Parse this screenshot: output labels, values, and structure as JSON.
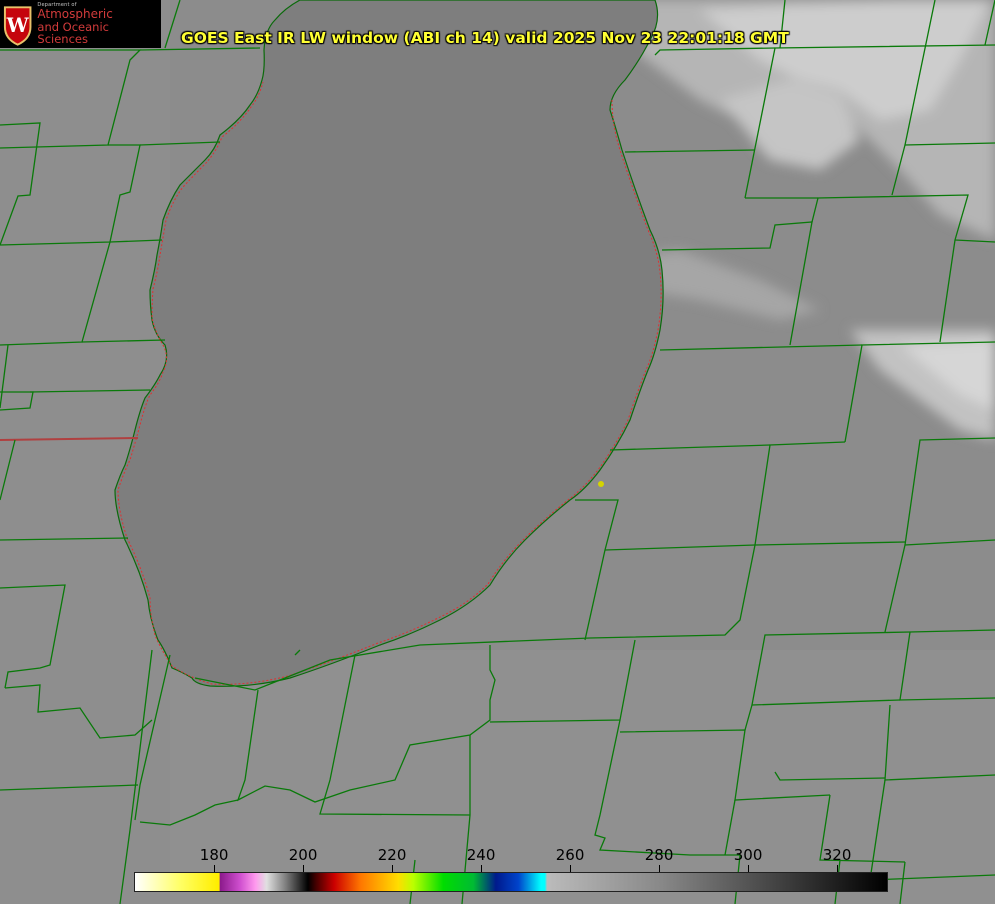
{
  "logo": {
    "dept": "Department of",
    "line1": "Atmospheric",
    "line2": "and Oceanic Sciences",
    "seal_letter": "W"
  },
  "title": "GOES East IR LW window (ABI ch 14) valid 2025 Nov 23 22:01:18 GMT",
  "colorbar": {
    "ticks": [
      {
        "label": "180",
        "value": 180
      },
      {
        "label": "200",
        "value": 200
      },
      {
        "label": "220",
        "value": 220
      },
      {
        "label": "240",
        "value": 240
      },
      {
        "label": "260",
        "value": 260
      },
      {
        "label": "280",
        "value": 280
      },
      {
        "label": "300",
        "value": 300
      },
      {
        "label": "320",
        "value": 320
      }
    ],
    "min": 162,
    "max": 331
  },
  "colors": {
    "background_gray": "#8a8a8a",
    "lake_gray": "#7f7f7f",
    "cloud_light": "#cfcfcf",
    "county_lines": "#0a7a0a",
    "shoreline_dots": "#e03030",
    "title_yellow": "#ffff33",
    "marker_yellow": "#d4d400"
  },
  "map": {
    "features": [
      "lake-michigan-southern-basin",
      "county-boundaries",
      "state-boundaries",
      "city-marker"
    ]
  }
}
